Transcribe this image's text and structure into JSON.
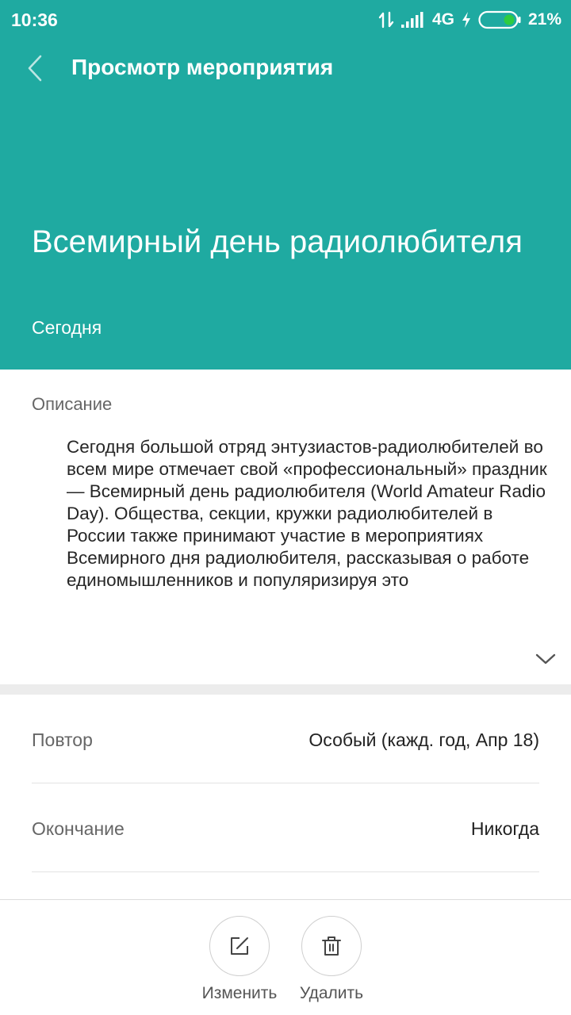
{
  "status_bar": {
    "time": "10:36",
    "network": "4G",
    "battery": "21%"
  },
  "app_bar": {
    "title": "Просмотр мероприятия"
  },
  "event": {
    "title": "Всемирный день радиолюбителя",
    "date": "Сегодня"
  },
  "description": {
    "label": "Описание",
    "text": "Сегодня большой отряд энтузиастов-радиолюбителей во всем мире отмечает свой «профессиональный» праздник — Всемирный день радиолюбителя (World Amateur Radio Day). Общества, секции, кружки радиолюбителей в России также принимают участие в мероприятиях Всемирного дня радиолюбителя, рассказывая о работе единомышленников и популяризируя это"
  },
  "details": {
    "repeat": {
      "label": "Повтор",
      "value": "Особый (кажд. год, Апр 18)"
    },
    "end": {
      "label": "Окончание",
      "value": "Никогда"
    }
  },
  "actions": {
    "edit_label": "Изменить",
    "delete_label": "Удалить"
  },
  "colors": {
    "header": "#1faaa1",
    "battery_fill": "#2ecc40"
  },
  "icons": {
    "back": "chevron-left-icon",
    "expand": "chevron-down-icon",
    "edit": "edit-icon",
    "delete": "trash-icon"
  }
}
